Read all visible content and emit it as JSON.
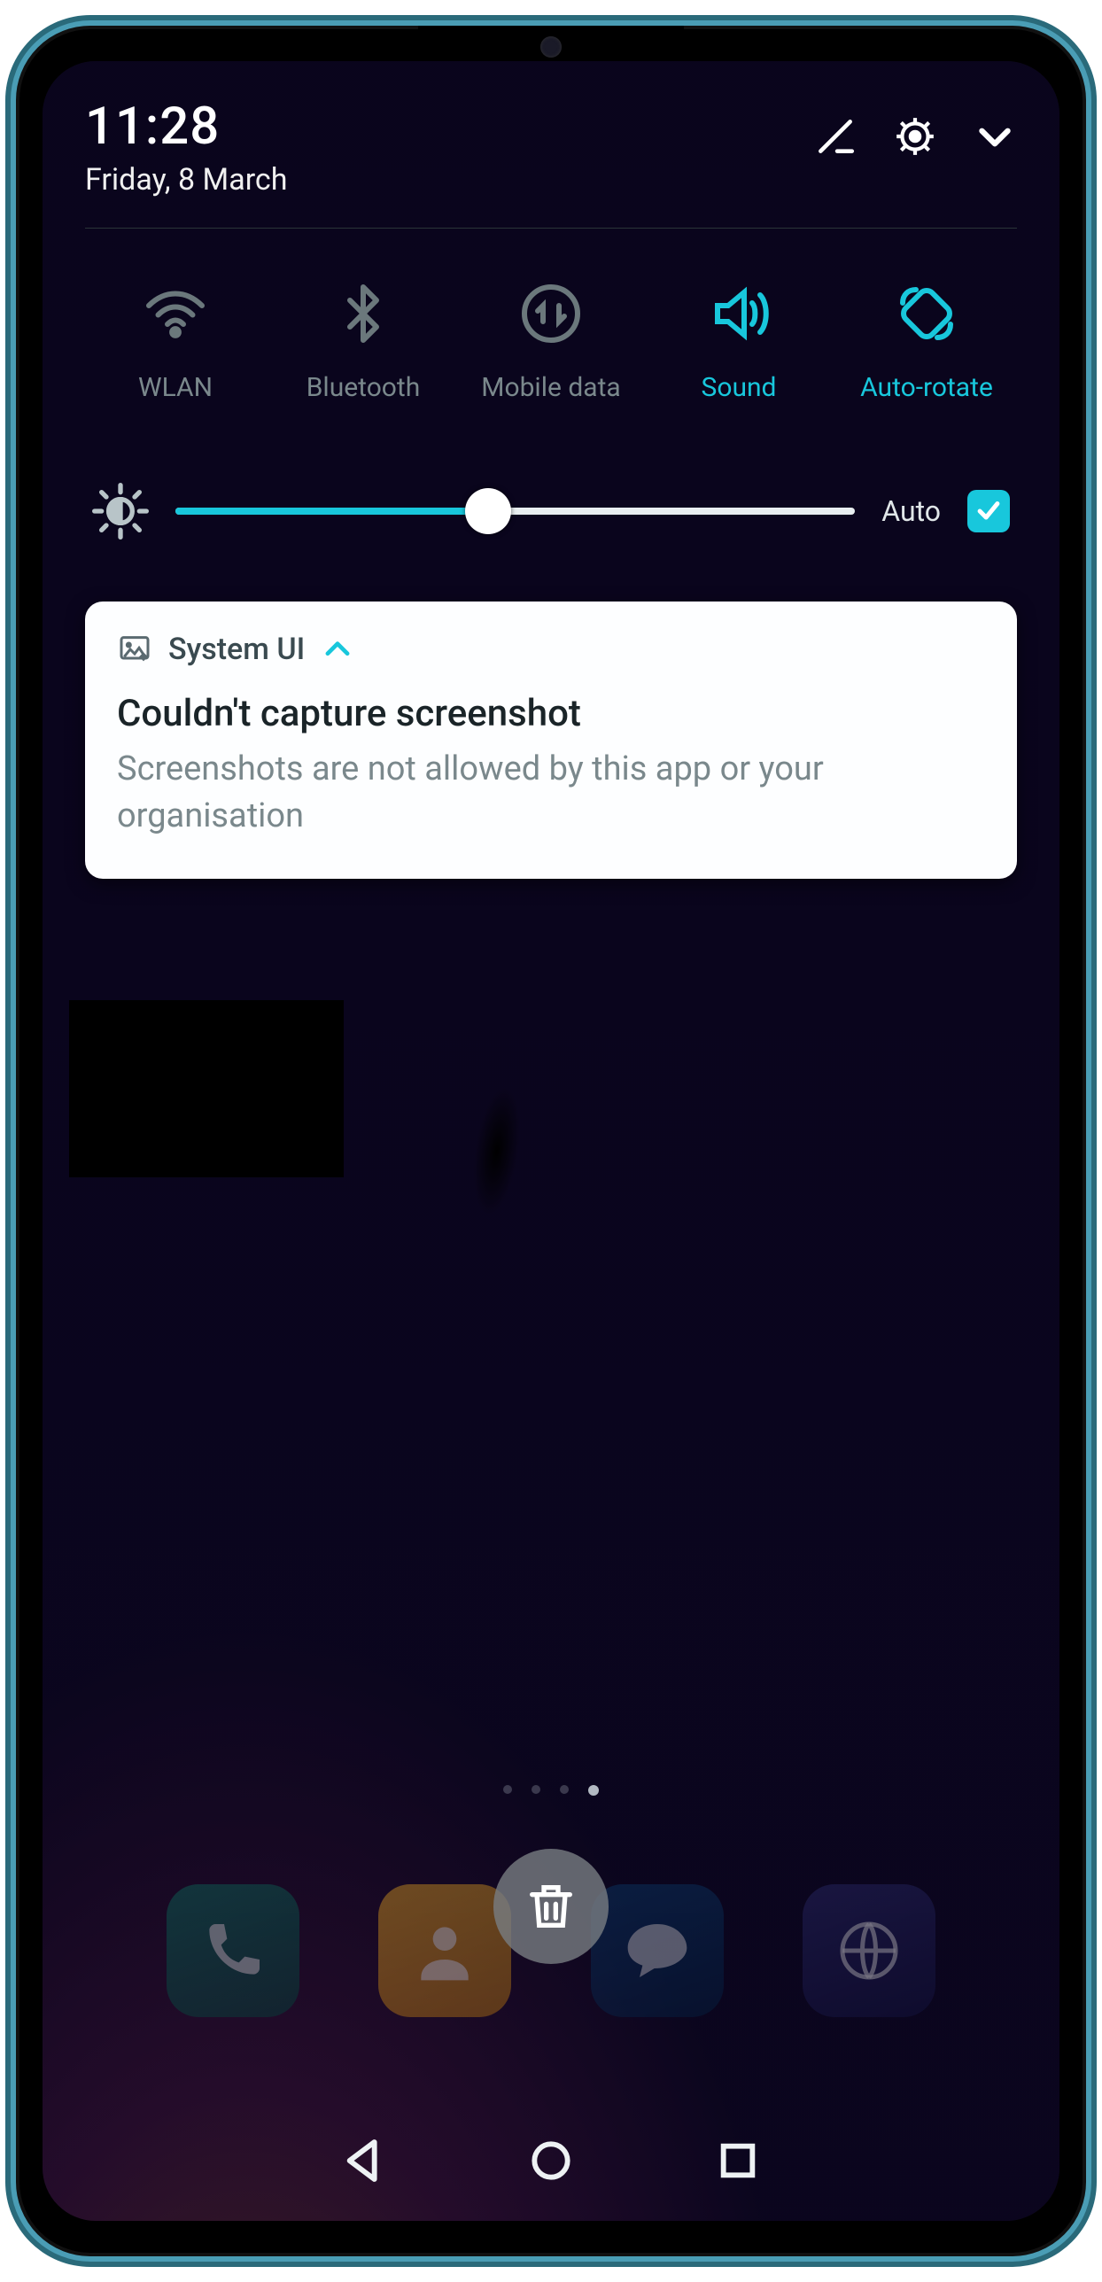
{
  "header": {
    "time": "11:28",
    "date": "Friday, 8 March"
  },
  "quick_settings": {
    "items": [
      {
        "label": "WLAN",
        "active": false
      },
      {
        "label": "Bluetooth",
        "active": false
      },
      {
        "label": "Mobile data",
        "active": false
      },
      {
        "label": "Sound",
        "active": true
      },
      {
        "label": "Auto-rotate",
        "active": true
      }
    ]
  },
  "brightness": {
    "value_percent": 46,
    "auto_label": "Auto",
    "auto_checked": true
  },
  "notification": {
    "app_name": "System UI",
    "title": "Couldn't capture screenshot",
    "body": "Screenshots are not allowed by this app or your organisation"
  },
  "colors": {
    "accent": "#18c7dc",
    "dim": "#7a888c"
  }
}
